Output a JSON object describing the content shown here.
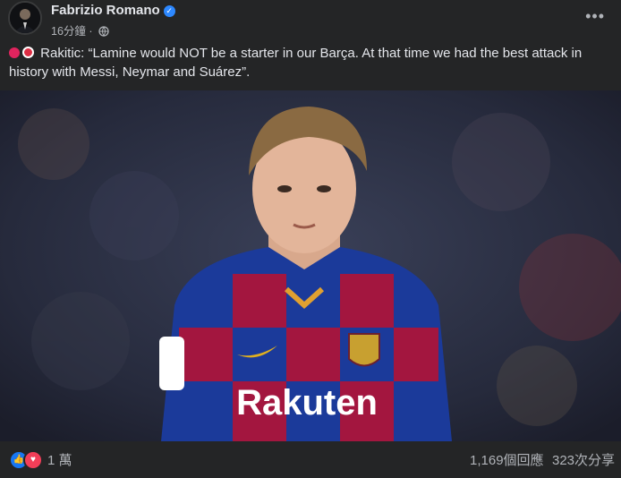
{
  "post": {
    "author": "Fabrizio Romano",
    "time": "16分鐘",
    "privacy_icon": "globe-icon",
    "text": "Rakitic: “Lamine would NOT be a starter in our Barça. At that time we had the best attack in history with Messi, Neymar and Suárez”.",
    "emojis": [
      "police-light-icon",
      "no-entry-icon"
    ],
    "photo": {
      "shirt_sponsor": "Rakuten",
      "colors": {
        "blue": "#1b3a9a",
        "garnet": "#a3163f",
        "crowd": "#2a2f45"
      }
    }
  },
  "footer": {
    "reaction_icons": [
      "like-icon",
      "love-icon"
    ],
    "reaction_count": "1 萬",
    "comments": "1,169個回應",
    "shares": "323次分享"
  },
  "colors": {
    "accent": "#2d88ff",
    "like": "#1877f2",
    "love": "#f33e58",
    "background": "#242526"
  }
}
